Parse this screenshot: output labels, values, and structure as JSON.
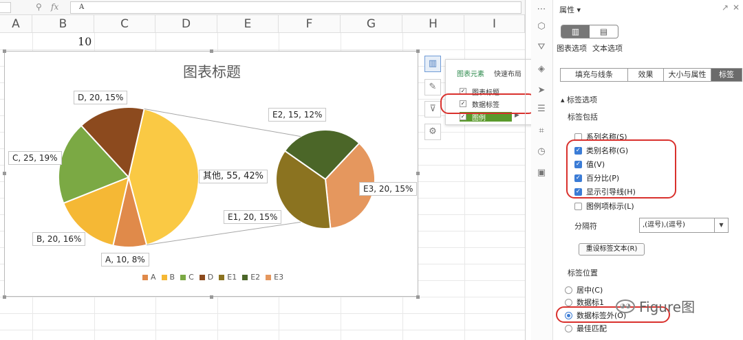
{
  "formula_bar": {
    "fx_label": "fx",
    "content": "A"
  },
  "sheet": {
    "columns": [
      "A",
      "B",
      "C",
      "D",
      "E",
      "F",
      "G",
      "H",
      "I"
    ],
    "cell_value": "10"
  },
  "chart_data": {
    "type": "pie",
    "subtype": "pie-of-pie",
    "title": "图表标题",
    "legend_position": "bottom",
    "main_pie": [
      {
        "label": "A",
        "value": 10,
        "percent": "8%",
        "color": "#E08A4A"
      },
      {
        "label": "B",
        "value": 20,
        "percent": "16%",
        "color": "#F5B835"
      },
      {
        "label": "C",
        "value": 25,
        "percent": "19%",
        "color": "#7BA944"
      },
      {
        "label": "D",
        "value": 20,
        "percent": "15%",
        "color": "#8C4A1E"
      },
      {
        "label": "其他",
        "value": 55,
        "percent": "42%",
        "color": "#FAC944"
      }
    ],
    "secondary_pie": [
      {
        "label": "E1",
        "value": 20,
        "percent": "15%",
        "color": "#8B7320"
      },
      {
        "label": "E2",
        "value": 15,
        "percent": "12%",
        "color": "#4B6628"
      },
      {
        "label": "E3",
        "value": 20,
        "percent": "15%",
        "color": "#E5975E"
      }
    ],
    "data_labels": {
      "A": "A, 10, 8%",
      "B": "B, 20, 16%",
      "C": "C, 25, 19%",
      "D": "D, 20, 15%",
      "other": "其他, 55, 42%",
      "E1": "E1, 20, 15%",
      "E2": "E2, 15, 12%",
      "E3": "E3, 20, 15%"
    },
    "legend": [
      {
        "label": "A",
        "color": "#E08A4A"
      },
      {
        "label": "B",
        "color": "#F5B835"
      },
      {
        "label": "C",
        "color": "#7BA944"
      },
      {
        "label": "D",
        "color": "#8C4A1E"
      },
      {
        "label": "E1",
        "color": "#8B7320"
      },
      {
        "label": "E2",
        "color": "#4B6628"
      },
      {
        "label": "E3",
        "color": "#E5975E"
      }
    ]
  },
  "chart_popup": {
    "tabs": [
      "图表元素",
      "快速布局"
    ],
    "items": [
      {
        "label": "图表标题",
        "checked": true
      },
      {
        "label": "数据标签",
        "checked": true
      },
      {
        "label": "图例",
        "checked": true
      }
    ]
  },
  "panel": {
    "title": "属性",
    "seg_labels": [
      "图表选项",
      "文本选项"
    ],
    "tabs": [
      "填充与线条",
      "效果",
      "大小与属性",
      "标签"
    ],
    "section_title": "标签选项",
    "include_title": "标签包括",
    "include_items": [
      {
        "label": "系列名称(S)",
        "checked": false
      },
      {
        "label": "类别名称(G)",
        "checked": true
      },
      {
        "label": "值(V)",
        "checked": true
      },
      {
        "label": "百分比(P)",
        "checked": true
      },
      {
        "label": "显示引导线(H)",
        "checked": true
      },
      {
        "label": "图例项标示(L)",
        "checked": false
      }
    ],
    "separator_label": "分隔符",
    "separator_value": ",(逗号),(逗号)",
    "reset_button": "重设标签文本(R)",
    "position_title": "标签位置",
    "position_items": [
      {
        "label": "居中(C)",
        "selected": false
      },
      {
        "label": "数据标1",
        "selected": false
      },
      {
        "label": "数据标签外(O)",
        "selected": true
      },
      {
        "label": "最佳匹配",
        "selected": false
      }
    ]
  },
  "watermark": {
    "text": "Figure图",
    "icon": "wechat-icon"
  },
  "colors": {
    "accent_blue": "#3B7CD6",
    "highlight_red": "#D9302C",
    "active_green": "#2D8A4C"
  }
}
